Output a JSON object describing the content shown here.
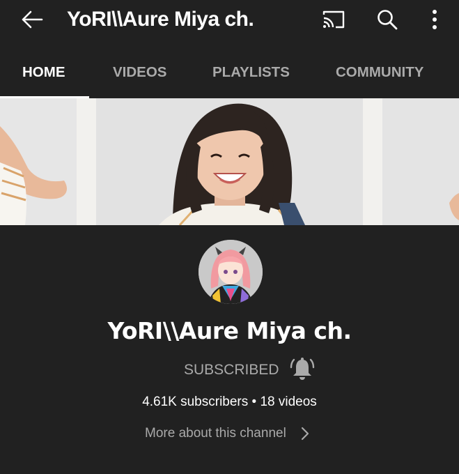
{
  "app_bar": {
    "title": "YoRI\\\\Aure Miya ch.",
    "icons": [
      "back-arrow-icon",
      "cast-icon",
      "search-icon",
      "more-vertical-icon"
    ]
  },
  "tabs": [
    {
      "label": "HOME",
      "active": true
    },
    {
      "label": "VIDEOS",
      "active": false
    },
    {
      "label": "PLAYLISTS",
      "active": false
    },
    {
      "label": "COMMUNITY",
      "active": false
    }
  ],
  "channel": {
    "name": "YoRI\\\\Aure Miya ch.",
    "subscribe_status": "SUBSCRIBED",
    "stats": "4.61K subscribers • 18 videos",
    "more_about": "More about this channel"
  },
  "colors": {
    "background": "#212121",
    "text_primary": "#ffffff",
    "text_secondary": "#aaaaaa"
  }
}
